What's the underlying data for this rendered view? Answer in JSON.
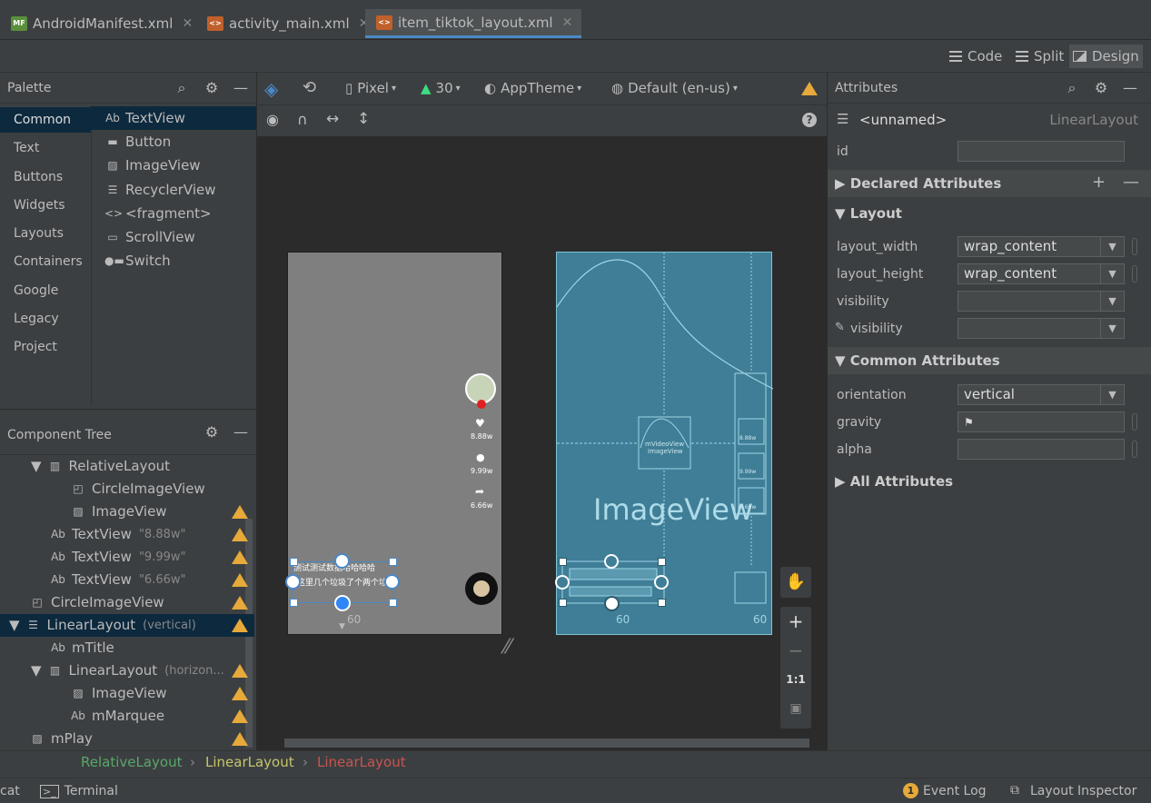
{
  "tabs": [
    {
      "icon": "MF",
      "label": "AndroidManifest.xml"
    },
    {
      "icon": "<>",
      "label": "activity_main.xml"
    },
    {
      "icon": "<>",
      "label": "item_tiktok_layout.xml"
    }
  ],
  "modes": {
    "code": "Code",
    "split": "Split",
    "design": "Design"
  },
  "palette": {
    "title": "Palette",
    "categories": [
      "Common",
      "Text",
      "Buttons",
      "Widgets",
      "Layouts",
      "Containers",
      "Google",
      "Legacy",
      "Project"
    ],
    "items": [
      "TextView",
      "Button",
      "ImageView",
      "RecyclerView",
      "<fragment>",
      "ScrollView",
      "Switch"
    ]
  },
  "toolbar": {
    "device": "Pixel",
    "api": "30",
    "theme": "AppTheme",
    "locale": "Default (en-us)"
  },
  "tree": {
    "title": "Component Tree",
    "rows": [
      {
        "label": "RelativeLayout",
        "dim": ""
      },
      {
        "label": "CircleImageView",
        "dim": ""
      },
      {
        "label": "ImageView",
        "dim": ""
      },
      {
        "label": "TextView",
        "dim": "\"8.88w\""
      },
      {
        "label": "TextView",
        "dim": "\"9.99w\""
      },
      {
        "label": "TextView",
        "dim": "\"6.66w\""
      },
      {
        "label": "CircleImageView",
        "dim": ""
      },
      {
        "label": "LinearLayout",
        "dim": "(vertical)"
      },
      {
        "label": "mTitle",
        "dim": ""
      },
      {
        "label": "LinearLayout",
        "dim": "(horizon..."
      },
      {
        "label": "ImageView",
        "dim": ""
      },
      {
        "label": "mMarquee",
        "dim": ""
      },
      {
        "label": "mPlay",
        "dim": ""
      }
    ]
  },
  "preview": {
    "likes": "8.88w",
    "comments": "9.99w",
    "shares": "6.66w",
    "title_text": "测试测试数据哈哈哈哈",
    "marquee_text": "这里几个垃圾了个两个垃",
    "number": "60",
    "blueprint_label": "ImageView",
    "blueprint_small": "mVideoView",
    "blueprint_small2": "ImageView",
    "bp_v1": "8.88w",
    "bp_v2": "9.99w",
    "bp_v3": "6.66w"
  },
  "zoom": {
    "ratio": "1:1"
  },
  "attributes": {
    "title": "Attributes",
    "component": "<unnamed>",
    "component_type": "LinearLayout",
    "id_label": "id",
    "id_value": "",
    "declared": "Declared Attributes",
    "layout_section": "Layout",
    "layout_width_label": "layout_width",
    "layout_width": "wrap_content",
    "layout_height_label": "layout_height",
    "layout_height": "wrap_content",
    "visibility_label": "visibility",
    "visibility": "",
    "tools_visibility_label": "visibility",
    "tools_visibility": "",
    "common_section": "Common Attributes",
    "orientation_label": "orientation",
    "orientation": "vertical",
    "gravity_label": "gravity",
    "gravity": "",
    "alpha_label": "alpha",
    "alpha": "",
    "all": "All Attributes"
  },
  "breadcrumb": [
    "RelativeLayout",
    "LinearLayout",
    "LinearLayout"
  ],
  "statusbar": {
    "left": "cat",
    "terminal": "Terminal",
    "event_log": "Event Log",
    "event_count": "1",
    "inspector": "Layout Inspector"
  },
  "colors": {
    "accent": "#4a88c7",
    "warning": "#e6a93a",
    "blueprint": "#3f7e96",
    "bc1": "#59a869",
    "bc2": "#c5c56b",
    "bc3": "#c75450"
  }
}
